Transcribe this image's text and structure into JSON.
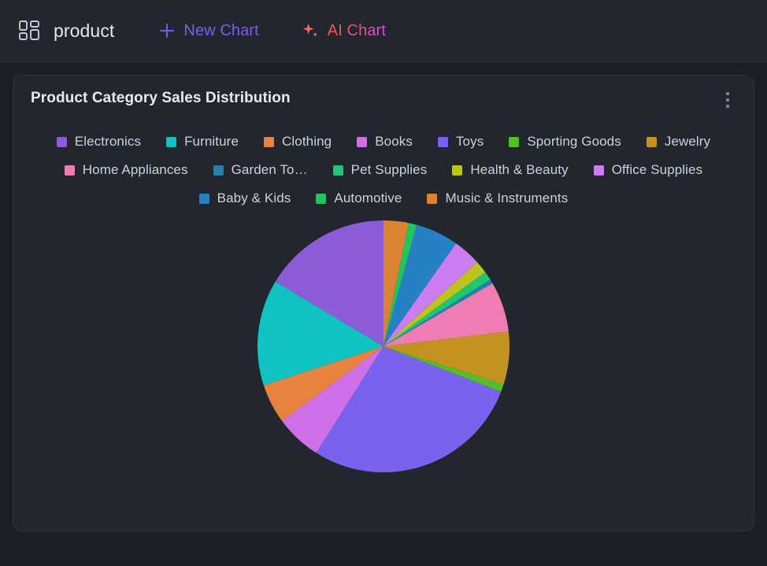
{
  "topbar": {
    "brand_icon": "grid-dashboard-icon",
    "brand_name": "product",
    "new_chart": {
      "icon": "plus-icon",
      "label": "New Chart"
    },
    "ai_chart": {
      "icon": "sparkle-icon",
      "label": "AI Chart"
    }
  },
  "card": {
    "title": "Product Category Sales Distribution",
    "menu_icon": "kebab-menu-icon"
  },
  "colors": {
    "page_background": "#1b1f27",
    "panel_background": "#22262f",
    "panel_border": "#2d323c",
    "text_primary": "#e7ebf1",
    "text_secondary": "#ccd2dc",
    "accent_new_chart": "#7b5cf0",
    "accent_ai_gradient_from": "#f4642e",
    "accent_ai_gradient_to": "#d94bf5"
  },
  "chart_data": {
    "type": "pie",
    "title": "Product Category Sales Distribution",
    "legend_position": "top",
    "start_angle_deg": 0,
    "direction": "counterclockwise",
    "center": [
      452,
      462
    ],
    "radius": 160,
    "categories": [
      "Electronics",
      "Furniture",
      "Clothing",
      "Books",
      "Toys",
      "Sporting Goods",
      "Jewelry",
      "Home Appliances",
      "Garden To…",
      "Pet Supplies",
      "Health & Beauty",
      "Office Supplies",
      "Baby & Kids",
      "Automotive",
      "Music & Instruments"
    ],
    "full_labels": [
      "Electronics",
      "Furniture",
      "Clothing",
      "Books",
      "Toys",
      "Sporting Goods",
      "Jewelry",
      "Home Appliances",
      "Garden Tools",
      "Pet Supplies",
      "Health & Beauty",
      "Office Supplies",
      "Baby & Kids",
      "Automotive",
      "Music & Instruments"
    ],
    "values": [
      15.5,
      12.8,
      4.8,
      5.6,
      26.5,
      0.9,
      6.4,
      6.1,
      0.5,
      1.1,
      1.5,
      3.4,
      5.2,
      1.0,
      3.0
    ],
    "unit": "percent",
    "colors": [
      "#8b5cd6",
      "#0fc4c0",
      "#e8823f",
      "#d070e8",
      "#7a62ee",
      "#4fbf2a",
      "#c29320",
      "#f07cb4",
      "#2580ad",
      "#1fc774",
      "#bdc41b",
      "#cc7df0",
      "#2680c4",
      "#22c45c",
      "#db8332"
    ]
  },
  "legend_items": [
    {
      "label": "Electronics",
      "color": "#8b5cd6"
    },
    {
      "label": "Furniture",
      "color": "#0fc4c0"
    },
    {
      "label": "Clothing",
      "color": "#e8823f"
    },
    {
      "label": "Books",
      "color": "#d070e8"
    },
    {
      "label": "Toys",
      "color": "#7a62ee"
    },
    {
      "label": "Sporting Goods",
      "color": "#4fbf2a"
    },
    {
      "label": "Jewelry",
      "color": "#c29320"
    },
    {
      "label": "Home Appliances",
      "color": "#f07cb4"
    },
    {
      "label": "Garden To…",
      "color": "#2580ad"
    },
    {
      "label": "Pet Supplies",
      "color": "#1fc774"
    },
    {
      "label": "Health & Beauty",
      "color": "#bdc41b"
    },
    {
      "label": "Office Supplies",
      "color": "#cc7df0"
    },
    {
      "label": "Baby & Kids",
      "color": "#2680c4"
    },
    {
      "label": "Automotive",
      "color": "#22c45c"
    },
    {
      "label": "Music & Instruments",
      "color": "#db8332"
    }
  ]
}
